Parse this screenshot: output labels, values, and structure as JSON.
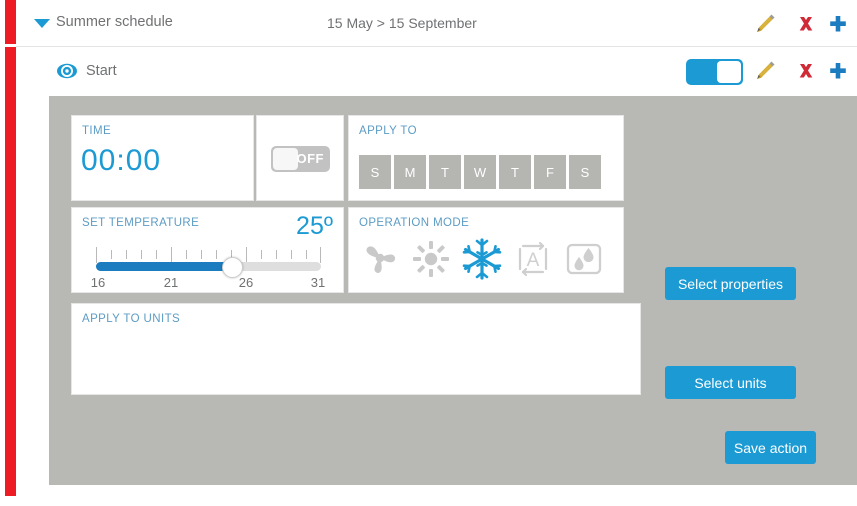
{
  "schedule": {
    "title": "Summer schedule",
    "date_range": "15 May > 15 September",
    "caret_icon": "chevron-down-icon",
    "edit_icon": "pencil-icon",
    "delete_icon": "close-x-icon",
    "add_icon": "plus-icon"
  },
  "action": {
    "title": "Start",
    "visibility_icon": "eye-icon",
    "enabled": true,
    "edit_icon": "pencil-icon",
    "delete_icon": "close-x-icon",
    "add_icon": "plus-icon"
  },
  "time_card": {
    "label": "TIME",
    "value": "00:00"
  },
  "off_toggle": {
    "label": "OFF",
    "state": "off"
  },
  "apply_to": {
    "label": "APPLY TO",
    "days": [
      {
        "label": "S",
        "selected": false
      },
      {
        "label": "M",
        "selected": false
      },
      {
        "label": "T",
        "selected": false
      },
      {
        "label": "W",
        "selected": false
      },
      {
        "label": "T",
        "selected": false
      },
      {
        "label": "F",
        "selected": false
      },
      {
        "label": "S",
        "selected": false
      }
    ]
  },
  "set_temperature": {
    "label": "SET TEMPERATURE",
    "value": "25º",
    "value_number": 25,
    "min": 16,
    "max": 31,
    "scale_labels": [
      "16",
      "21",
      "26",
      "31"
    ]
  },
  "operation_mode": {
    "label": "OPERATION MODE",
    "modes": [
      {
        "name": "fan-icon",
        "selected": false
      },
      {
        "name": "sun-heat-icon",
        "selected": false
      },
      {
        "name": "snowflake-cool-icon",
        "selected": true
      },
      {
        "name": "auto-mode-icon",
        "selected": false
      },
      {
        "name": "dry-humidity-icon",
        "selected": false
      }
    ]
  },
  "apply_to_units": {
    "label": "APPLY TO UNITS",
    "items": []
  },
  "buttons": {
    "select_properties": "Select properties",
    "select_units": "Select units",
    "save_action": "Save action"
  },
  "colors": {
    "accent_blue": "#1b9ad3",
    "slider_blue": "#1b7dc0",
    "label_blue": "#5c9cc4",
    "delete_red": "#cf2a35",
    "status_red": "#ed1c24",
    "panel_grey": "#b8b8b4",
    "day_grey": "#b5b5b2"
  }
}
